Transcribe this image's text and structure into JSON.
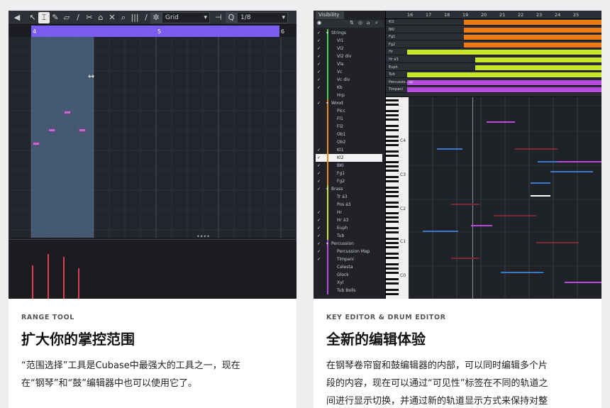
{
  "left_card": {
    "toolbar": {
      "quantize_label": "Grid",
      "quantize_value": "1/8"
    },
    "ruler_marks": [
      "4",
      "5",
      "6"
    ],
    "tag": "RANGE TOOL",
    "title": "扩大你的掌控范围",
    "description_line1": "“范围选择”工具是Cubase中最强大的工具之一，现在",
    "description_line2": "在“钢琴”和“鼓”编辑器中也可以使用它了。"
  },
  "right_card": {
    "visibility_tab": "Visibility",
    "ruler_marks": [
      "16",
      "17",
      "18",
      "19",
      "20",
      "21",
      "22",
      "23",
      "24",
      "25"
    ],
    "visibility_rows": [
      {
        "label": "Strings",
        "type": "folder",
        "checked": true,
        "color": "#4ad14a"
      },
      {
        "label": "Vl1",
        "type": "track",
        "checked": true,
        "color": "#4ad14a"
      },
      {
        "label": "Vl2",
        "type": "track",
        "checked": true,
        "color": "#4ad14a"
      },
      {
        "label": "Vl2 div",
        "type": "track",
        "checked": true,
        "color": "#4ad14a"
      },
      {
        "label": "Vla",
        "type": "track",
        "checked": true,
        "color": "#4ad14a"
      },
      {
        "label": "Vc",
        "type": "track",
        "checked": true,
        "color": "#4ad14a"
      },
      {
        "label": "Vc div",
        "type": "track",
        "checked": true,
        "color": "#4ad14a"
      },
      {
        "label": "Kb",
        "type": "track",
        "checked": true,
        "color": "#4ad14a"
      },
      {
        "label": "Hrp",
        "type": "track",
        "checked": false,
        "color": "#4ad14a"
      },
      {
        "label": "Wood",
        "type": "folder",
        "checked": true,
        "color": "#f08a1a"
      },
      {
        "label": "Picc",
        "type": "track",
        "checked": false,
        "color": "#f08a1a"
      },
      {
        "label": "Fl1",
        "type": "track",
        "checked": false,
        "color": "#f08a1a"
      },
      {
        "label": "Fl2",
        "type": "track",
        "checked": false,
        "color": "#f08a1a"
      },
      {
        "label": "Ob1",
        "type": "track",
        "checked": false,
        "color": "#f08a1a"
      },
      {
        "label": "Ob2",
        "type": "track",
        "checked": false,
        "color": "#f08a1a"
      },
      {
        "label": "Kl1",
        "type": "track",
        "checked": true,
        "color": "#f08a1a"
      },
      {
        "label": "Kl2",
        "type": "track",
        "checked": true,
        "color": "#f08a1a",
        "selected": true
      },
      {
        "label": "BKl",
        "type": "track",
        "checked": true,
        "color": "#f08a1a"
      },
      {
        "label": "Fg1",
        "type": "track",
        "checked": true,
        "color": "#f08a1a"
      },
      {
        "label": "Fg2",
        "type": "track",
        "checked": true,
        "color": "#f08a1a"
      },
      {
        "label": "Brass",
        "type": "folder",
        "checked": true,
        "color": "#c8e62a"
      },
      {
        "label": "Tr á3",
        "type": "track",
        "checked": false,
        "color": "#c8e62a"
      },
      {
        "label": "Pos á3",
        "type": "track",
        "checked": false,
        "color": "#c8e62a"
      },
      {
        "label": "Hr",
        "type": "track",
        "checked": true,
        "color": "#c8e62a"
      },
      {
        "label": "Hr á3",
        "type": "track",
        "checked": true,
        "color": "#c8e62a"
      },
      {
        "label": "Euph",
        "type": "track",
        "checked": true,
        "color": "#c8e62a"
      },
      {
        "label": "Tub",
        "type": "track",
        "checked": true,
        "color": "#c8e62a"
      },
      {
        "label": "Percussion",
        "type": "folder",
        "checked": true,
        "color": "#b84ae0"
      },
      {
        "label": "Percussion Map",
        "type": "track",
        "checked": true,
        "color": "#b84ae0"
      },
      {
        "label": "Timpani",
        "type": "track",
        "checked": true,
        "color": "#b84ae0"
      },
      {
        "label": "Celesta",
        "type": "track",
        "checked": false,
        "color": "#b84ae0"
      },
      {
        "label": "Glock",
        "type": "track",
        "checked": false,
        "color": "#b84ae0"
      },
      {
        "label": "Xyl",
        "type": "track",
        "checked": false,
        "color": "#b84ae0"
      },
      {
        "label": "Tub Bells",
        "type": "track",
        "checked": false,
        "color": "#b84ae0"
      }
    ],
    "arrange_tracks": [
      {
        "label": "Kl2",
        "color": "#f07a12"
      },
      {
        "label": "BKl",
        "color": "#f07a12"
      },
      {
        "label": "Fg1",
        "color": "#f07a12"
      },
      {
        "label": "Fg2",
        "color": "#f07a12"
      },
      {
        "label": "Hr",
        "color": "#c8e62a"
      },
      {
        "label": "Hr á3",
        "color": "#c8e62a"
      },
      {
        "label": "Euph",
        "color": "#c8e62a"
      },
      {
        "label": "Tub",
        "color": "#c8e62a"
      },
      {
        "label": "Percussio...ap",
        "color": "#b84ae0"
      },
      {
        "label": "Timpani",
        "color": "#b84ae0"
      }
    ],
    "octave_labels": [
      "C4",
      "C3",
      "C2",
      "C1",
      "C0"
    ],
    "tag": "KEY EDITOR & DRUM EDITOR",
    "title": "全新的编辑体验",
    "description_line1": "在钢琴卷帘窗和鼓编辑器的内部，可以同时编辑多个片",
    "description_line2": "段的内容，现在可以通过“可见性”标签在不同的轨道之",
    "description_line3": "间进行显示切换，并通过新的轨道显示方式来保持对整"
  }
}
